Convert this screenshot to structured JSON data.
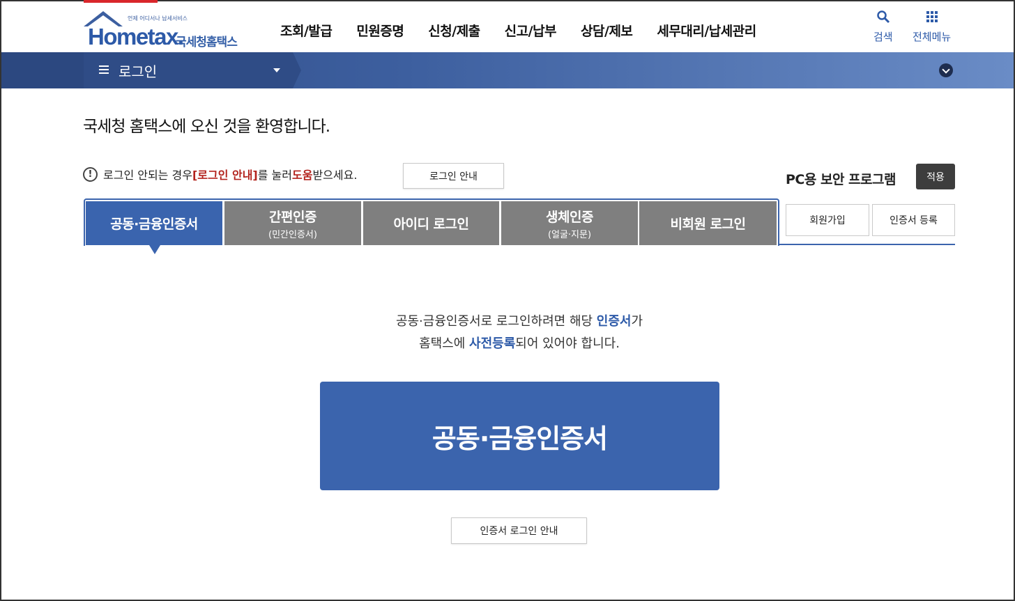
{
  "header": {
    "logo_tagline": "언제 어디서나 납세서비스",
    "logo_word": "Hometax.",
    "logo_kr": "국세청홈택스",
    "menu": [
      "조회/발급",
      "민원증명",
      "신청/제출",
      "신고/납부",
      "상담/제보",
      "세무대리/납세관리"
    ],
    "search_label": "검색",
    "allmenu_label": "전체메뉴"
  },
  "navbar": {
    "title": "로그인"
  },
  "welcome": "국세청 홈택스에 오신 것을 환영합니다.",
  "notice": {
    "icon": "!",
    "pre": "로그인 안되는 경우 ",
    "link": "[로그인 안내]",
    "mid": "를 눌러 ",
    "help": "도움",
    "post": "받으세요.",
    "guide_button": "로그인 안내"
  },
  "security": {
    "label": "PC용 보안 프로그램",
    "apply_button": "적용"
  },
  "tabs": [
    {
      "label": "공동·금융인증서",
      "sub": ""
    },
    {
      "label": "간편인증",
      "sub": "(민간인증서)"
    },
    {
      "label": "아이디 로그인",
      "sub": ""
    },
    {
      "label": "생체인증",
      "sub": "(얼굴·지문)"
    },
    {
      "label": "비회원 로그인",
      "sub": ""
    }
  ],
  "side_buttons": {
    "join": "회원가입",
    "register_cert": "인증서 등록"
  },
  "info": {
    "line1_pre": "공동·금융인증서로 로그인하려면 해당 ",
    "line1_em": "인증서",
    "line1_post": "가",
    "line2_pre": "홈택스에 ",
    "line2_em": "사전등록",
    "line2_post": "되어 있어야 합니다."
  },
  "main_button": "공동·금융인증서",
  "cert_guide_button": "인증서 로그인 안내",
  "colors": {
    "brand": "#3b64ad",
    "tab_inactive": "#7f7f7f",
    "emphasis_red": "#b3231d"
  }
}
